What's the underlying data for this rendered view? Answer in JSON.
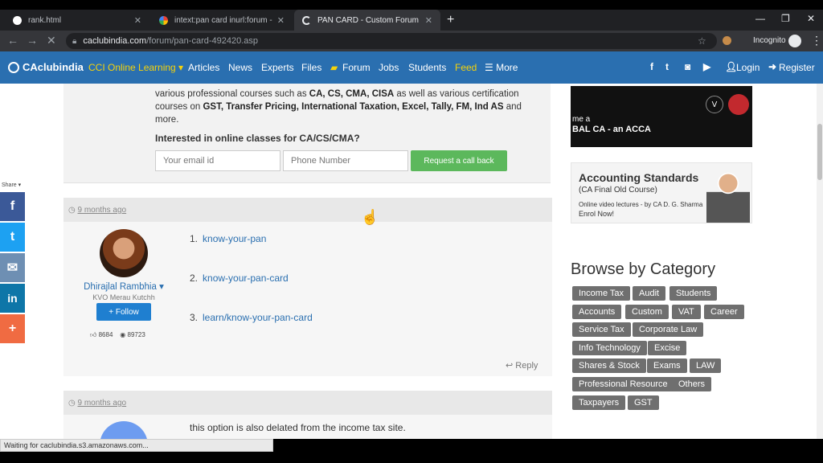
{
  "browser": {
    "tabs": [
      {
        "title": "rank.html",
        "active": false
      },
      {
        "title": "intext:pan card inurl:forum - Goo",
        "active": false
      },
      {
        "title": "PAN CARD - Custom Forum",
        "active": true
      }
    ],
    "url_host": "caclubindia.com",
    "url_path": "/forum/pan-card-492420.asp",
    "incognito_label": "Incognito",
    "status_text": "Waiting for caclubindia.s3.amazonaws.com..."
  },
  "nav": {
    "logo": "CAclubindia",
    "items": [
      "CCI Online Learning ▾",
      "Articles",
      "News",
      "Experts",
      "Files",
      "Forum",
      "Jobs",
      "Students",
      "Feed",
      "☰ More"
    ],
    "login": "Login",
    "register": "Register"
  },
  "promo": {
    "line1_pre": "various professional courses such as ",
    "line1_b": "CA, CS, CMA, CISA",
    "line1_post": " as well as various certification",
    "line2_pre": "courses on ",
    "line2_b": "GST, Transfer Pricing, International Taxation, Excel, Tally, FM, Ind AS",
    "line2_post": " and",
    "line3": "more.",
    "question": "Interested in online classes for CA/CS/CMA?",
    "email_placeholder": "Your email id",
    "phone_placeholder": "Phone Number",
    "button": "Request a call back"
  },
  "posts": [
    {
      "time": "9 months ago",
      "user": "Dhirajlal Rambhia ▾",
      "location": "KVO Merau Kutchh",
      "follow": "+ Follow",
      "likes": "8684",
      "views": "89723",
      "list": [
        {
          "num": "1.",
          "text": "know-your-pan"
        },
        {
          "num": "2.",
          "text": "know-your-pan-card"
        },
        {
          "num": "3.",
          "text": "learn/know-your-pan-card"
        }
      ],
      "reply": "Reply"
    },
    {
      "time": "9 months ago",
      "text": "this option is also delated from the income tax site."
    }
  ],
  "ads": {
    "banner1_line1": "me a",
    "banner1_line2": "BAL CA - an ACCA",
    "banner2_title": "Accounting Standards",
    "banner2_sub": "(CA Final Old Course)",
    "banner2_desc": "Online video lectures - by CA D. G. Sharma",
    "banner2_cta": "Enrol Now!"
  },
  "browse": {
    "title": "Browse by Category",
    "tags": [
      "Income Tax",
      "Audit",
      "Students",
      "Accounts",
      "Custom",
      "VAT",
      "Career",
      "Service Tax",
      "Corporate Law",
      "Info Technology",
      "Excise",
      "Shares & Stock",
      "Exams",
      "LAW",
      "Professional Resource",
      "Others",
      "Taxpayers",
      "GST"
    ]
  },
  "share": {
    "label": "Share ▾"
  }
}
